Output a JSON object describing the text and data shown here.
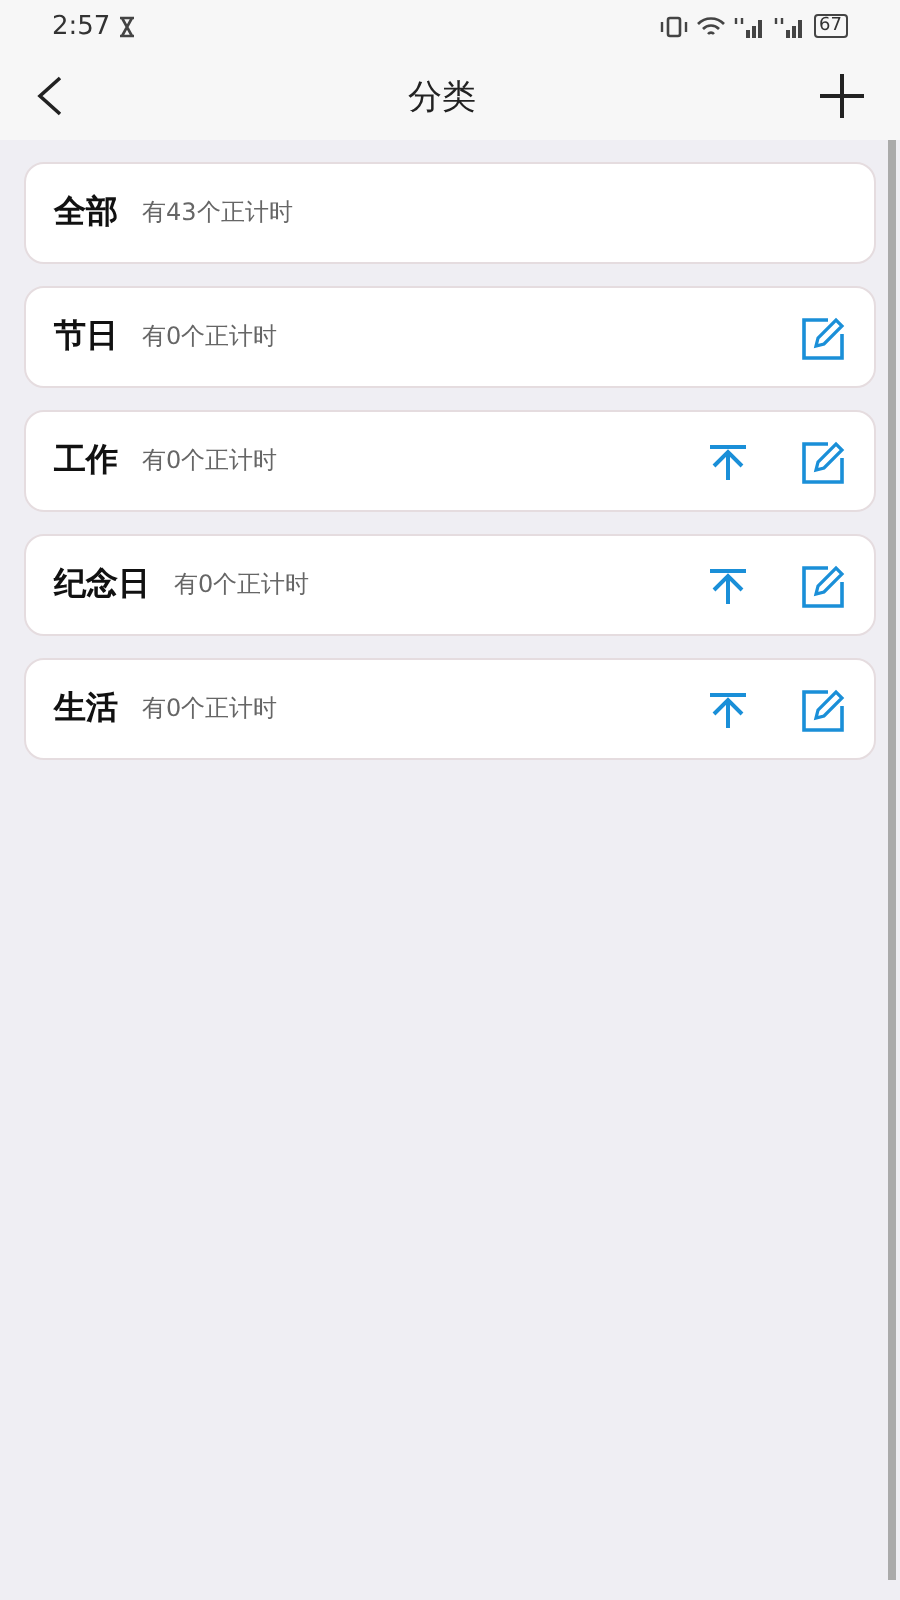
{
  "status_bar": {
    "time": "2:57",
    "battery": "67"
  },
  "header": {
    "title": "分类"
  },
  "categories": [
    {
      "name": "全部",
      "count": "有43个正计时",
      "pinnable": false,
      "editable": false
    },
    {
      "name": "节日",
      "count": "有0个正计时",
      "pinnable": false,
      "editable": true
    },
    {
      "name": "工作",
      "count": "有0个正计时",
      "pinnable": true,
      "editable": true
    },
    {
      "name": "纪念日",
      "count": "有0个正计时",
      "pinnable": true,
      "editable": true
    },
    {
      "name": "生活",
      "count": "有0个正计时",
      "pinnable": true,
      "editable": true
    }
  ]
}
